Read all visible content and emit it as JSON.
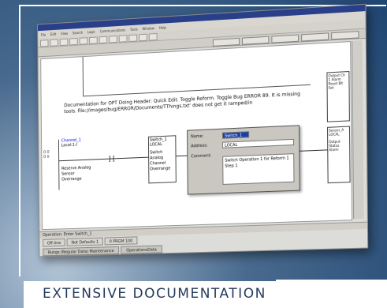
{
  "caption": "EXTENSIVE DOCUMENTATION",
  "colors": {
    "background": "#2f5783",
    "caption_text": "#243a5c",
    "selection": "#1a3fa8"
  },
  "app": {
    "menu": [
      "File",
      "Edit",
      "View",
      "Search",
      "Logic",
      "Communications",
      "Tools",
      "Window",
      "Help"
    ],
    "toolbar2_buttons": [
      "",
      "",
      "",
      "",
      ""
    ]
  },
  "documentation": {
    "text": "Documentation for OPT Doing Header: Quick Edit. Toggle Reform. Toggle Bug ERROR 89. It is missing tools. file://images/bug/ERROR/Documents/TThings.txt' does not get it ramped/in"
  },
  "rung": {
    "number": "0 0\n0 II",
    "contact": {
      "tag": "Channel_1",
      "address": "Local:1:I",
      "desc": "Reserve Analog Sensor Overrange"
    },
    "block": {
      "title": "Switch_1",
      "address": "LOCAL",
      "desc": "Switch Analog Channel Overrange"
    },
    "right_output": {
      "tag": "Sensor_A",
      "address": "LOCAL",
      "desc": "Output Status Alarm"
    },
    "right_top": {
      "text": "Output Ch 1 Alarm Reset Bit Set"
    }
  },
  "popup": {
    "name_label": "Name:",
    "name_value": "Switch_1",
    "address_label": "Address:",
    "address_value": "LOCAL",
    "comment_label": "Comment:",
    "comment_value": "Switch Operation 1 for Reform 1 Step 1"
  },
  "status": {
    "text": "Operation: Enter Switch_1"
  },
  "bottom_tabs": [
    "Off-line",
    "Not Defaults 1",
    "0 PRGM 100"
  ],
  "bottom_tabs2": [
    "Rungs (Regular Data) Maintenance",
    "OperationsData"
  ]
}
